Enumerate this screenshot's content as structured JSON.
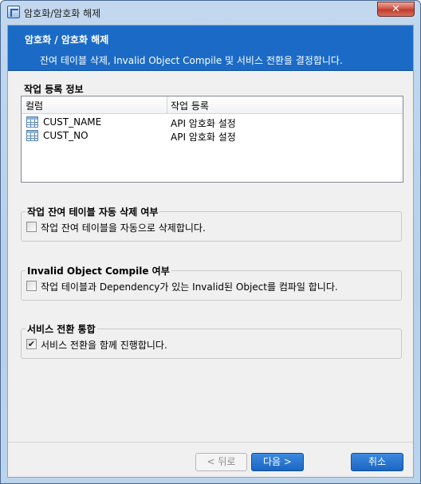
{
  "window": {
    "title": "암호화/암호화 해제",
    "close_label": "✕"
  },
  "header": {
    "title": "암호화 / 암호화 해제",
    "description": "잔여 테이블 삭제, Invalid Object Compile 및 서비스 전환을 결정합니다."
  },
  "task_info": {
    "label": "작업 등록 정보",
    "columns": [
      "컬럼",
      "작업 등록"
    ],
    "rows": [
      {
        "icon": "table-icon",
        "name": "CUST_NAME",
        "task": "API 암호화 설정"
      },
      {
        "icon": "table-icon",
        "name": "CUST_NO",
        "task": "API 암호화 설정"
      }
    ]
  },
  "group_delete": {
    "title": "작업 잔여 테이블 자동 삭제 여부",
    "checkbox_label": "작업 잔여 테이블을 자동으로 삭제합니다.",
    "checked": false
  },
  "group_compile": {
    "title": "Invalid Object Compile 여부",
    "checkbox_label": "작업 테이블과 Dependency가 있는 Invalid된 Object를 컴파일 합니다.",
    "checked": false
  },
  "group_service": {
    "title": "서비스 전환 통합",
    "checkbox_label": "서비스 전환을 함께 진행합니다.",
    "checked": true,
    "check_mark": "✔"
  },
  "buttons": {
    "back": "< 뒤로",
    "next": "다음 >",
    "cancel": "취소"
  }
}
